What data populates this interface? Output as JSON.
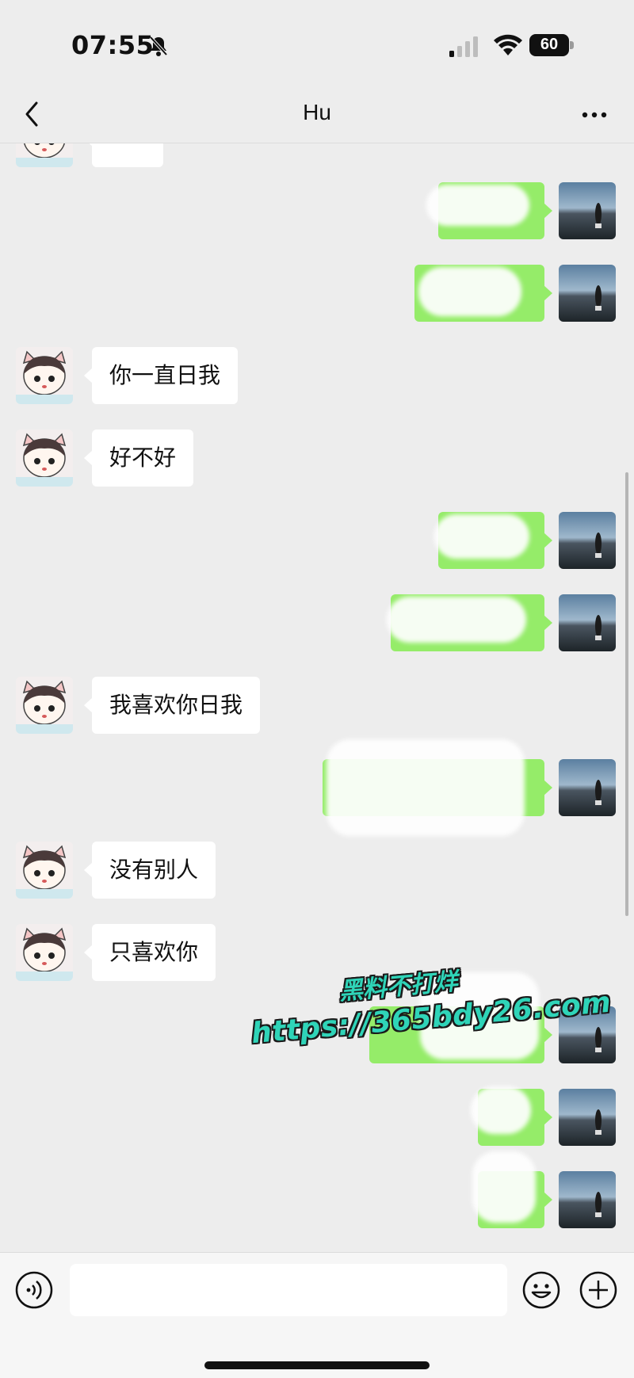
{
  "status_bar": {
    "time": "07:55",
    "battery_level": "60",
    "icons": [
      "bell-slash-icon",
      "signal-icon",
      "wifi-icon",
      "battery-icon"
    ]
  },
  "nav": {
    "title": "Hu",
    "back_icon": "chevron-left-icon",
    "more_icon": "more-dots-icon"
  },
  "messages": [
    {
      "side": "in",
      "text": ""
    },
    {
      "side": "out",
      "text": ""
    },
    {
      "side": "out",
      "text": ""
    },
    {
      "side": "in",
      "text": "你一直日我"
    },
    {
      "side": "in",
      "text": "好不好"
    },
    {
      "side": "out",
      "text": ""
    },
    {
      "side": "out",
      "text": ""
    },
    {
      "side": "in",
      "text": "我喜欢你日我"
    },
    {
      "side": "out",
      "text": ""
    },
    {
      "side": "in",
      "text": "没有别人"
    },
    {
      "side": "in",
      "text": "只喜欢你"
    },
    {
      "side": "out",
      "text": ""
    },
    {
      "side": "out",
      "text": ""
    },
    {
      "side": "out",
      "text": ""
    }
  ],
  "watermark": {
    "line1": "黑料不打烊",
    "line2": "https://365bdy26.com"
  },
  "input_bar": {
    "text_value": "",
    "icons": [
      "voice-icon",
      "emoji-icon",
      "plus-icon"
    ]
  },
  "colors": {
    "background": "#ededed",
    "outgoing_bubble": "#95ec69",
    "incoming_bubble": "#ffffff",
    "watermark": "#2fd4b8"
  }
}
